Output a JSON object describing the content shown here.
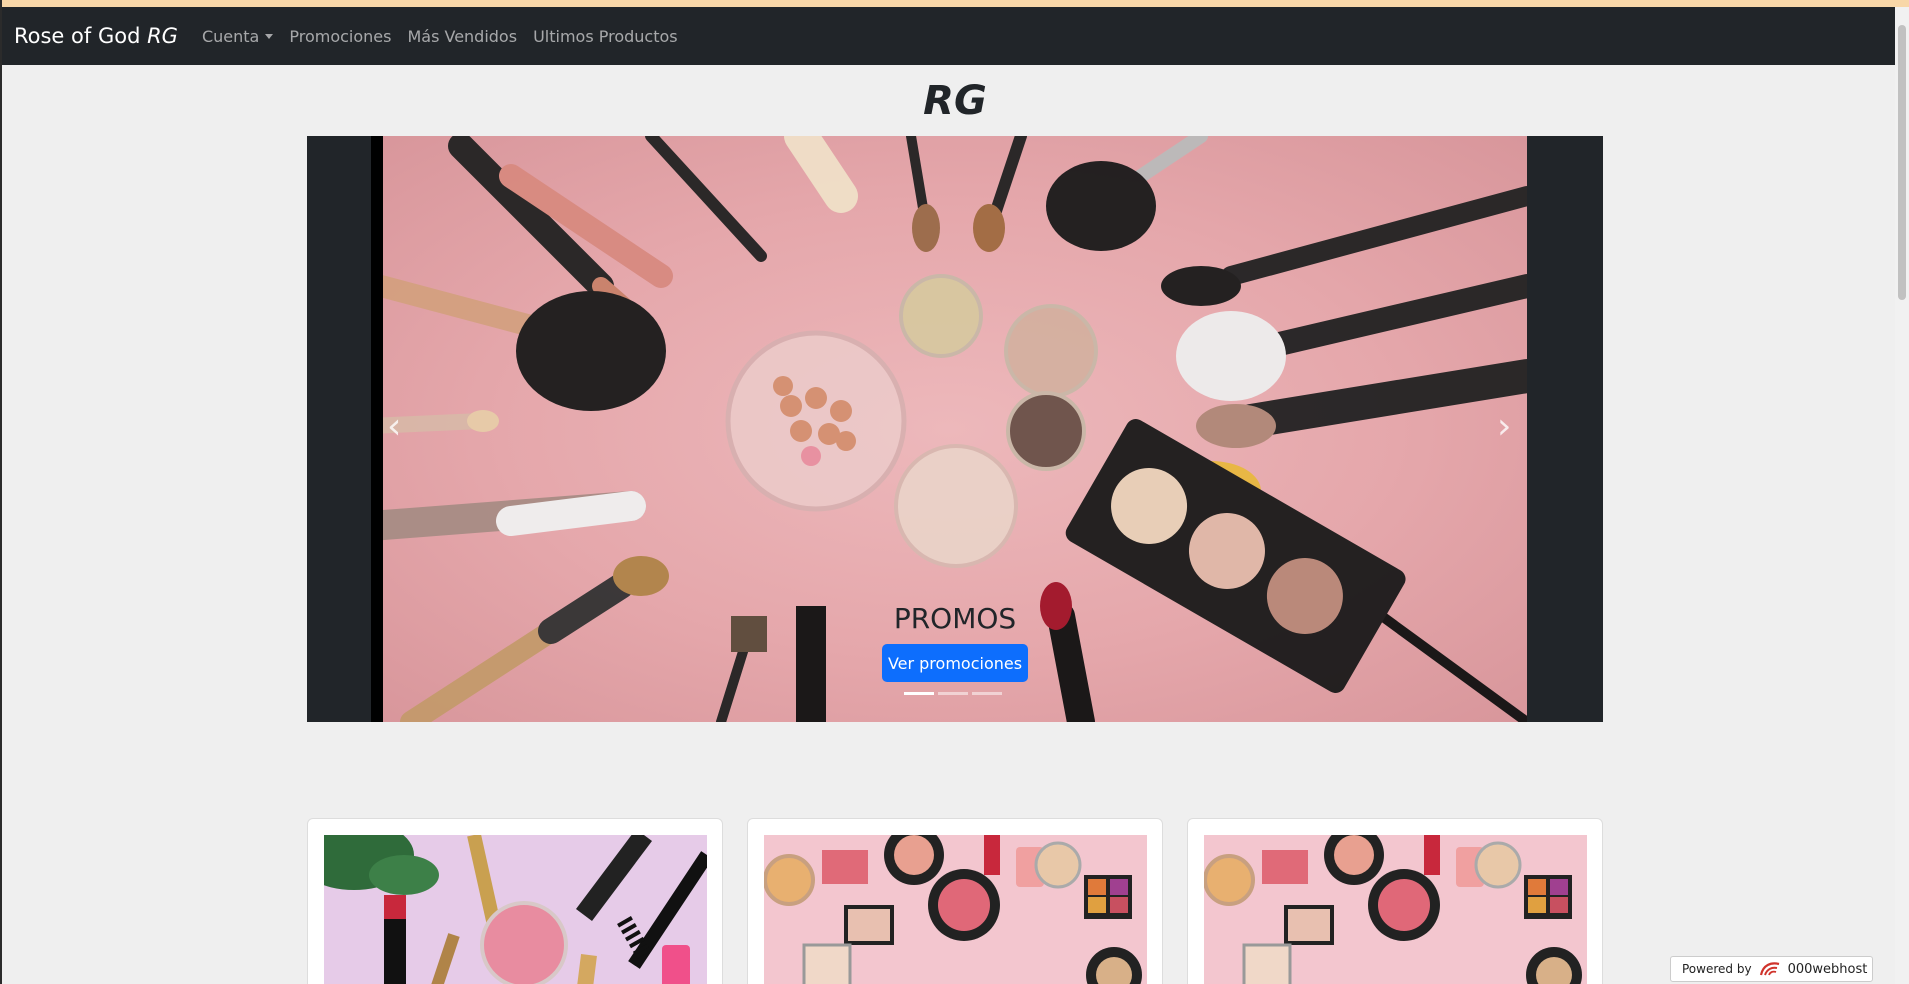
{
  "navbar": {
    "brand_text": "Rose of God",
    "brand_italic": "RG",
    "items": [
      {
        "label": "Cuenta",
        "dropdown": true
      },
      {
        "label": "Promociones"
      },
      {
        "label": "Más Vendidos"
      },
      {
        "label": "Ultimos Productos"
      }
    ]
  },
  "page": {
    "heading": "RG"
  },
  "carousel": {
    "caption_title": "PROMOS",
    "button_label": "Ver promociones",
    "prev_icon": "chevron-left-icon",
    "next_icon": "chevron-right-icon",
    "prev_glyph": "‹",
    "next_glyph": "›",
    "active_slide": 1,
    "slide_count": 3
  },
  "cards": [
    {
      "image": "makeup products on lavender background"
    },
    {
      "image": "makeup palettes on pink background"
    },
    {
      "image": "makeup palettes on pink background"
    }
  ],
  "footer_badge": {
    "prefix": "Powered by",
    "brand": "000webhost"
  },
  "colors": {
    "navbar": "#212529",
    "primary": "#0d6efd",
    "background": "#efefef",
    "accent_top": "#f8d7a8"
  }
}
